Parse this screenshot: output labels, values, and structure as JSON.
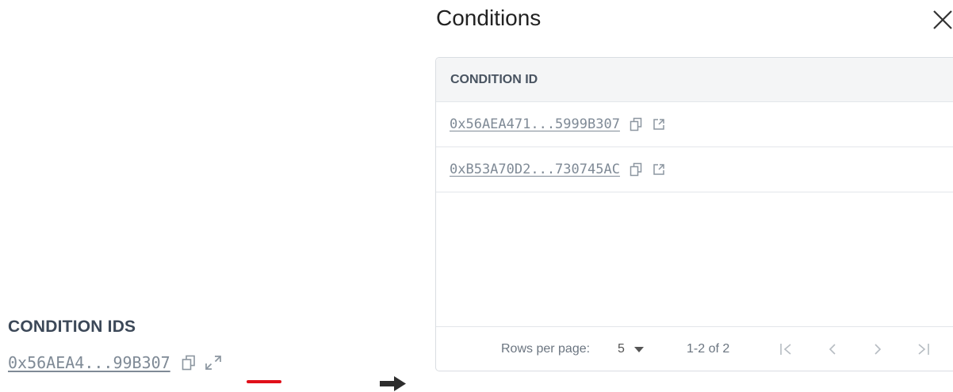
{
  "left": {
    "heading": "CONDITION IDS",
    "hash": "0x56AEA4...99B307",
    "copy_icon": "copy-icon",
    "expand_icon": "expand-icon",
    "highlight_color": "#e0101a"
  },
  "modal": {
    "title": "Conditions",
    "close_icon": "close-icon",
    "table": {
      "header": "CONDITION ID",
      "rows": [
        {
          "hash": "0x56AEA471...5999B307"
        },
        {
          "hash": "0xB53A70D2...730745AC"
        }
      ]
    },
    "footer": {
      "rows_per_page_label": "Rows per page:",
      "rows_per_page_value": "5",
      "range": "1-2 of 2"
    }
  },
  "colors": {
    "link": "#7f8a96",
    "heading": "#3c4858",
    "icon": "#8c96a0"
  }
}
